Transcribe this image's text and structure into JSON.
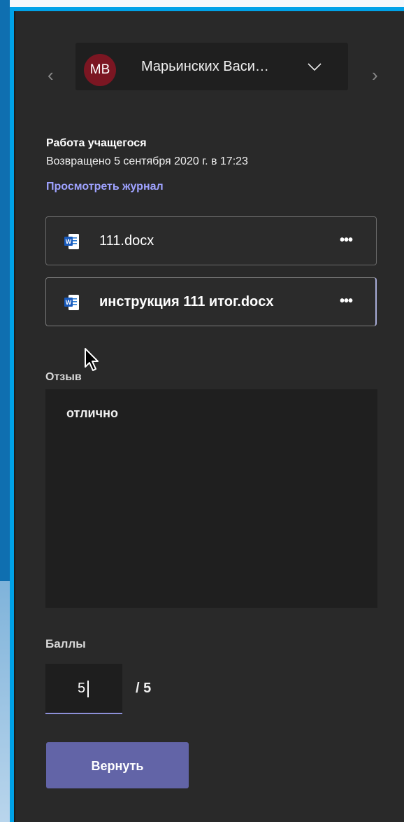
{
  "student": {
    "initials": "MB",
    "name": "Марьинских Васи…",
    "avatar_color": "#7b1622"
  },
  "nav": {
    "prev_icon": "chevron-left-icon",
    "next_icon": "chevron-right-icon",
    "dropdown_icon": "chevron-down-icon"
  },
  "submission": {
    "title": "Работа учащегося",
    "returned": "Возвращено 5 сентября 2020 г. в 17:23",
    "view_log": "Просмотреть журнал"
  },
  "attachments": [
    {
      "name": "111.docx",
      "icon": "word-document-icon",
      "more": "•••"
    },
    {
      "name": "инструкция 111 итог.docx",
      "icon": "word-document-icon",
      "more": "•••"
    }
  ],
  "feedback": {
    "label": "Отзыв",
    "text": "отлично"
  },
  "points": {
    "label": "Баллы",
    "value": "5",
    "max": "/ 5"
  },
  "actions": {
    "return_label": "Вернуть"
  },
  "colors": {
    "accent": "#6264a7",
    "link": "#9ea2ff",
    "panel_bg": "#292929",
    "frame": "#00a2e8"
  }
}
